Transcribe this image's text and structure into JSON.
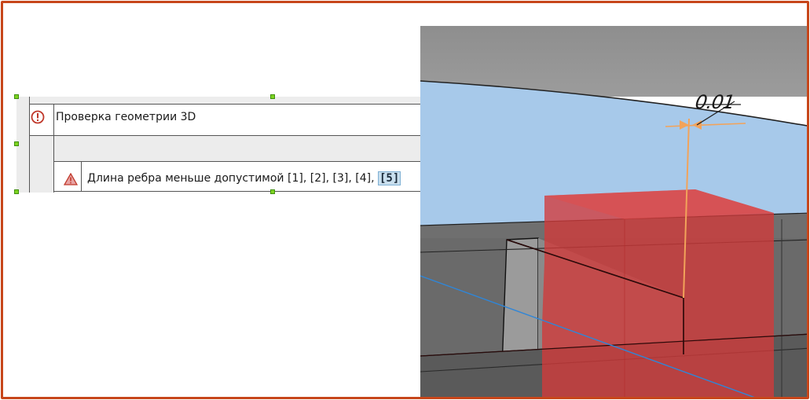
{
  "diagnostics": {
    "check_title": "Проверка геометрии 3D",
    "error_message": "Длина ребра меньше допустимой",
    "refs": [
      "[1]",
      "[2]",
      "[3]",
      "[4]",
      "[5]"
    ],
    "active_ref": "[5]",
    "icons": {
      "check": "info-circle-icon",
      "error": "warning-triangle-icon"
    }
  },
  "viewport": {
    "dimension_label": "0.01"
  },
  "colors": {
    "frame_border": "#c7461a",
    "sky": "#a7c9ea",
    "highlight_box": "#d23a3a",
    "dimension_line": "#f2a35a",
    "selection_handle": "#7ed321"
  }
}
